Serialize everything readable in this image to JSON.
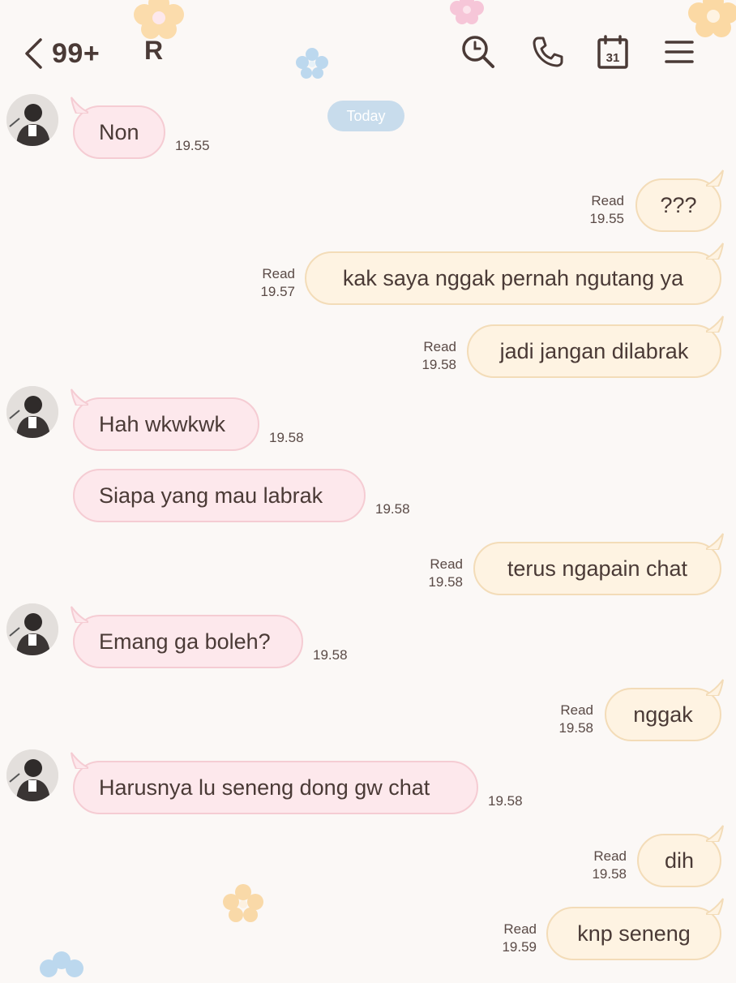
{
  "header": {
    "unread_count": "99+",
    "chat_name": "R"
  },
  "date_pill": "Today",
  "messages": [
    {
      "dir": "in",
      "text": "Non",
      "time": "19.55"
    },
    {
      "dir": "out",
      "text": "???",
      "status": "Read",
      "time": "19.55"
    },
    {
      "dir": "out",
      "text": "kak saya nggak pernah ngutang ya",
      "status": "Read",
      "time": "19.57"
    },
    {
      "dir": "out",
      "text": "jadi jangan dilabrak",
      "status": "Read",
      "time": "19.58"
    },
    {
      "dir": "in",
      "text": "Hah wkwkwk",
      "time": "19.58"
    },
    {
      "dir": "in",
      "text": "Siapa yang mau labrak",
      "time": "19.58"
    },
    {
      "dir": "out",
      "text": "terus ngapain chat",
      "status": "Read",
      "time": "19.58"
    },
    {
      "dir": "in",
      "text": "Emang ga boleh?",
      "time": "19.58"
    },
    {
      "dir": "out",
      "text": "nggak",
      "status": "Read",
      "time": "19.58"
    },
    {
      "dir": "in",
      "text": "Harusnya lu seneng dong gw chat",
      "time": "19.58"
    },
    {
      "dir": "out",
      "text": "dih",
      "status": "Read",
      "time": "19.58"
    },
    {
      "dir": "out",
      "text": "knp seneng",
      "status": "Read",
      "time": "19.59"
    }
  ],
  "icons": {
    "back": "chevron-left-icon",
    "search": "search-icon",
    "call": "phone-icon",
    "calendar": "calendar-icon",
    "calendar_day": "31",
    "menu": "menu-icon"
  },
  "colors": {
    "background": "#fbf8f6",
    "incoming_bubble": "#fde8ec",
    "outgoing_bubble": "#fef3e2",
    "text": "#4a3a36",
    "today_pill": "#c8dcec"
  }
}
